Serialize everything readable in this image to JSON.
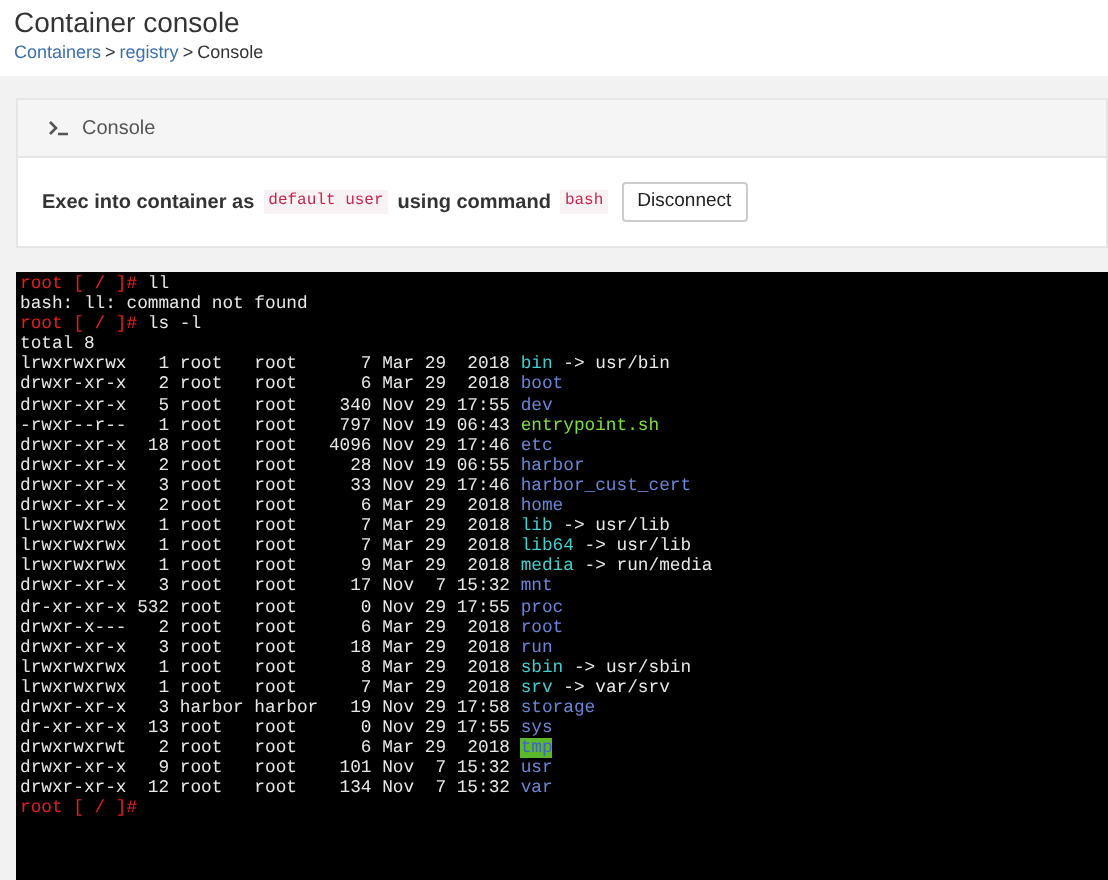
{
  "page": {
    "title": "Container console",
    "breadcrumb": [
      {
        "kind": "link",
        "label": "Containers"
      },
      {
        "kind": "separator",
        "label": ">"
      },
      {
        "kind": "link",
        "label": "registry"
      },
      {
        "kind": "separator",
        "label": ">"
      },
      {
        "kind": "current",
        "label": "Console"
      }
    ]
  },
  "panel": {
    "title": "Console",
    "exec": {
      "parts": [
        {
          "kind": "text",
          "text": "Exec into container as"
        },
        {
          "kind": "code",
          "text": "default user"
        },
        {
          "kind": "text",
          "text": "using command"
        },
        {
          "kind": "code",
          "text": "bash"
        }
      ],
      "button": "Disconnect"
    }
  },
  "terminal": {
    "lines": [
      {
        "kind": "prompt",
        "prompt": "root [ / ]#",
        "command": "ll"
      },
      {
        "kind": "output",
        "text": "bash: ll: command not found"
      },
      {
        "kind": "prompt",
        "prompt": "root [ / ]#",
        "command": "ls -l"
      },
      {
        "kind": "output",
        "text": "total 8"
      },
      {
        "kind": "entry",
        "info": "lrwxrwxrwx   1 root   root      7 Mar 29  2018",
        "name": "bin",
        "color": "#3fd0d0",
        "highlighted": false,
        "target": "-> usr/bin"
      },
      {
        "kind": "entry",
        "info": "drwxr-xr-x   2 root   root      6 Mar 29  2018",
        "name": "boot",
        "color": "#6b86d8",
        "highlighted": false
      },
      {
        "kind": "entry",
        "info": "drwxr-xr-x   5 root   root    340 Nov 29 17:55",
        "name": "dev",
        "color": "#6b86d8",
        "highlighted": false
      },
      {
        "kind": "entry",
        "info": "-rwxr--r--   1 root   root    797 Nov 19 06:43",
        "name": "entrypoint.sh",
        "color": "#7ee03a",
        "highlighted": false
      },
      {
        "kind": "entry",
        "info": "drwxr-xr-x  18 root   root   4096 Nov 29 17:46",
        "name": "etc",
        "color": "#6b86d8",
        "highlighted": false
      },
      {
        "kind": "entry",
        "info": "drwxr-xr-x   2 root   root     28 Nov 19 06:55",
        "name": "harbor",
        "color": "#6b86d8",
        "highlighted": false
      },
      {
        "kind": "entry",
        "info": "drwxr-xr-x   3 root   root     33 Nov 29 17:46",
        "name": "harbor_cust_cert",
        "color": "#6b86d8",
        "highlighted": false
      },
      {
        "kind": "entry",
        "info": "drwxr-xr-x   2 root   root      6 Mar 29  2018",
        "name": "home",
        "color": "#6b86d8",
        "highlighted": false
      },
      {
        "kind": "entry",
        "info": "lrwxrwxrwx   1 root   root      7 Mar 29  2018",
        "name": "lib",
        "color": "#3fd0d0",
        "highlighted": false,
        "target": "-> usr/lib"
      },
      {
        "kind": "entry",
        "info": "lrwxrwxrwx   1 root   root      7 Mar 29  2018",
        "name": "lib64",
        "color": "#3fd0d0",
        "highlighted": false,
        "target": "-> usr/lib"
      },
      {
        "kind": "entry",
        "info": "lrwxrwxrwx   1 root   root      9 Mar 29  2018",
        "name": "media",
        "color": "#3fd0d0",
        "highlighted": false,
        "target": "-> run/media"
      },
      {
        "kind": "entry",
        "info": "drwxr-xr-x   3 root   root     17 Nov  7 15:32",
        "name": "mnt",
        "color": "#6b86d8",
        "highlighted": false
      },
      {
        "kind": "entry",
        "info": "dr-xr-xr-x 532 root   root      0 Nov 29 17:55",
        "name": "proc",
        "color": "#6b86d8",
        "highlighted": false
      },
      {
        "kind": "entry",
        "info": "drwxr-x---   2 root   root      6 Mar 29  2018",
        "name": "root",
        "color": "#6b86d8",
        "highlighted": false
      },
      {
        "kind": "entry",
        "info": "drwxr-xr-x   3 root   root     18 Mar 29  2018",
        "name": "run",
        "color": "#6b86d8",
        "highlighted": false
      },
      {
        "kind": "entry",
        "info": "lrwxrwxrwx   1 root   root      8 Mar 29  2018",
        "name": "sbin",
        "color": "#3fd0d0",
        "highlighted": false,
        "target": "-> usr/sbin"
      },
      {
        "kind": "entry",
        "info": "lrwxrwxrwx   1 root   root      7 Mar 29  2018",
        "name": "srv",
        "color": "#3fd0d0",
        "highlighted": false,
        "target": "-> var/srv"
      },
      {
        "kind": "entry",
        "info": "drwxr-xr-x   3 harbor harbor   19 Nov 29 17:58",
        "name": "storage",
        "color": "#6b86d8",
        "highlighted": false
      },
      {
        "kind": "entry",
        "info": "dr-xr-xr-x  13 root   root      0 Nov 29 17:55",
        "name": "sys",
        "color": "#6b86d8",
        "highlighted": false
      },
      {
        "kind": "entry",
        "info": "drwxrwxrwt   2 root   root      6 Mar 29  2018",
        "name": "tmp",
        "color": "#5bb82a",
        "highlighted": true
      },
      {
        "kind": "entry",
        "info": "drwxr-xr-x   9 root   root    101 Nov  7 15:32",
        "name": "usr",
        "color": "#6b86d8",
        "highlighted": false
      },
      {
        "kind": "entry",
        "info": "drwxr-xr-x  12 root   root    134 Nov  7 15:32",
        "name": "var",
        "color": "#6b86d8",
        "highlighted": false
      },
      {
        "kind": "prompt",
        "prompt": "root [ / ]#"
      }
    ]
  }
}
